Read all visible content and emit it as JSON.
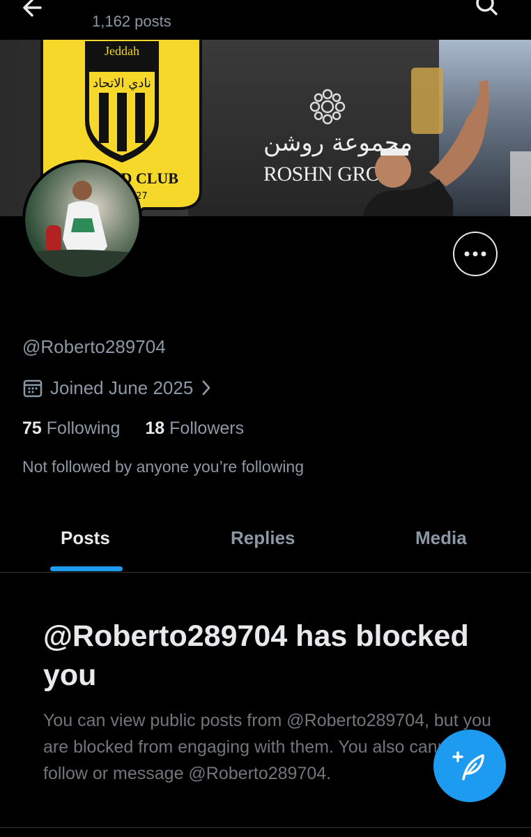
{
  "header": {
    "post_count": "1,162 posts"
  },
  "banner": {
    "crest_city": "Jeddah",
    "crest_arabic": "نادي الاتحاد",
    "crest_name": "ITTIHAD CLUB",
    "crest_years": "١٣٤٦ . 1927",
    "sponsor_arabic": "مجموعة روشن",
    "sponsor_name": "ROSHN GROUP"
  },
  "profile": {
    "handle": "@Roberto289704",
    "joined": "Joined June 2025",
    "following_count": "75",
    "following_label": "Following",
    "followers_count": "18",
    "followers_label": "Followers",
    "not_followed": "Not followed by anyone you’re following"
  },
  "tabs": [
    {
      "label": "Posts",
      "active": true
    },
    {
      "label": "Replies",
      "active": false
    },
    {
      "label": "Media",
      "active": false
    }
  ],
  "blocked": {
    "title": "@Roberto289704 has blocked you",
    "description": "You can view public posts from @Roberto289704, but you are blocked from engaging with them. You also cannot follow or message @Roberto289704."
  },
  "colors": {
    "background": "#000000",
    "accent": "#1d9bf0",
    "secondary_text": "#8b98a5",
    "crest_yellow": "#f5d82a"
  },
  "icons": {
    "back": "arrow-left-icon",
    "search": "search-icon",
    "more": "more-horizontal-icon",
    "calendar": "calendar-icon",
    "chevron": "chevron-right-icon",
    "compose": "compose-feather-icon"
  }
}
